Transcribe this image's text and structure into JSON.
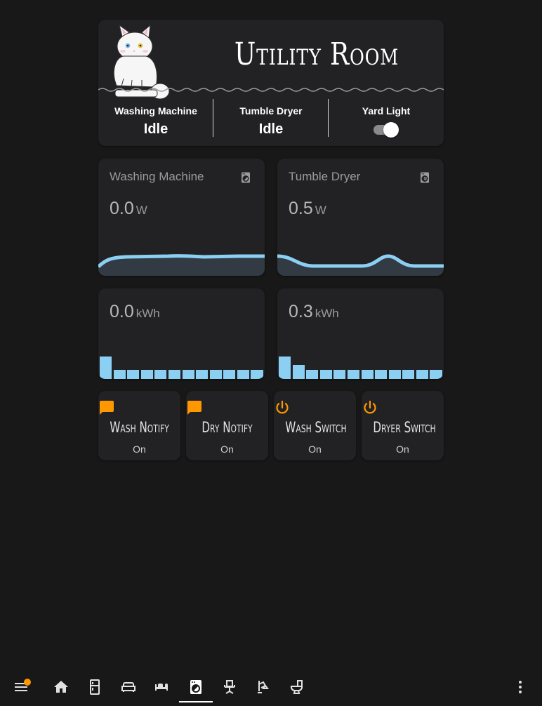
{
  "header": {
    "title": "Utility Room",
    "statuses": [
      {
        "label": "Washing Machine",
        "value": "Idle"
      },
      {
        "label": "Tumble Dryer",
        "value": "Idle"
      },
      {
        "label": "Yard Light",
        "toggle_on": true
      }
    ]
  },
  "power_cards": [
    {
      "title": "Washing Machine",
      "value": "0.0",
      "unit": "W",
      "icon": "washing-machine-icon"
    },
    {
      "title": "Tumble Dryer",
      "value": "0.5",
      "unit": "W",
      "icon": "tumble-dryer-icon"
    }
  ],
  "energy_cards": [
    {
      "value": "0.0",
      "unit": "kWh"
    },
    {
      "value": "0.3",
      "unit": "kWh"
    }
  ],
  "buttons": [
    {
      "name": "Wash Notify",
      "state": "On",
      "icon": "message-icon"
    },
    {
      "name": "Dry Notify",
      "state": "On",
      "icon": "message-icon"
    },
    {
      "name": "Wash Switch",
      "state": "On",
      "icon": "power-icon"
    },
    {
      "name": "Dryer Switch",
      "state": "On",
      "icon": "power-icon"
    }
  ],
  "colors": {
    "background": "#181818",
    "card": "#222225",
    "accent_orange": "#ff9800",
    "chart_line": "#8bcff2",
    "chart_fill": "#323b43"
  },
  "nav": {
    "icons": [
      "menu-icon",
      "home-icon",
      "fridge-icon",
      "sofa-icon",
      "bed-icon",
      "washing-machine-icon",
      "office-chair-icon",
      "desk-lamp-icon",
      "toilet-icon",
      "more-vertical-icon"
    ],
    "active": "washing-machine-icon",
    "badge": true
  }
}
